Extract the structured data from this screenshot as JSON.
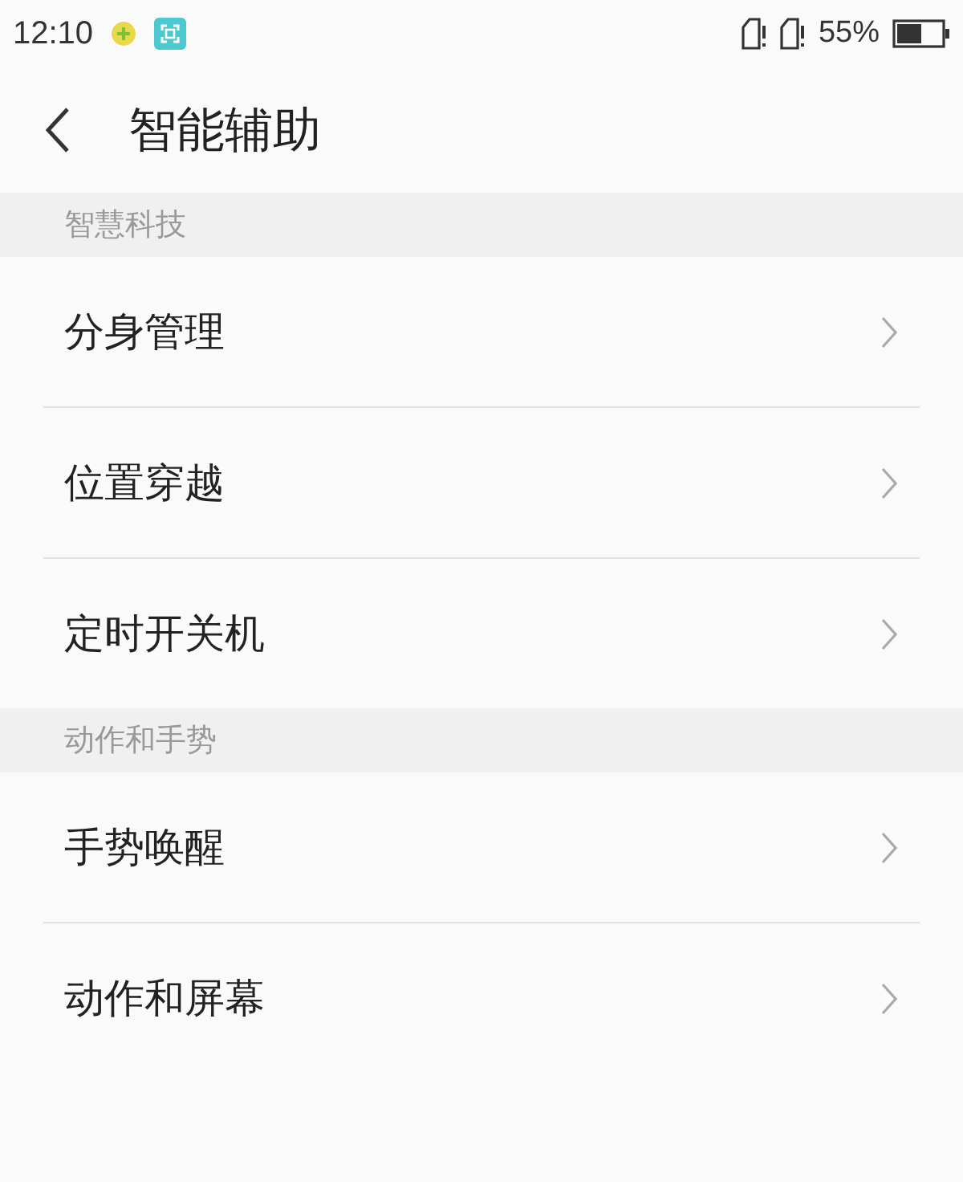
{
  "status_bar": {
    "time": "12:10",
    "battery": "55%"
  },
  "header": {
    "title": "智能辅助"
  },
  "sections": [
    {
      "title": "智慧科技",
      "items": [
        {
          "label": "分身管理"
        },
        {
          "label": "位置穿越"
        },
        {
          "label": "定时开关机"
        }
      ]
    },
    {
      "title": "动作和手势",
      "items": [
        {
          "label": "手势唤醒"
        },
        {
          "label": "动作和屏幕"
        }
      ]
    }
  ]
}
